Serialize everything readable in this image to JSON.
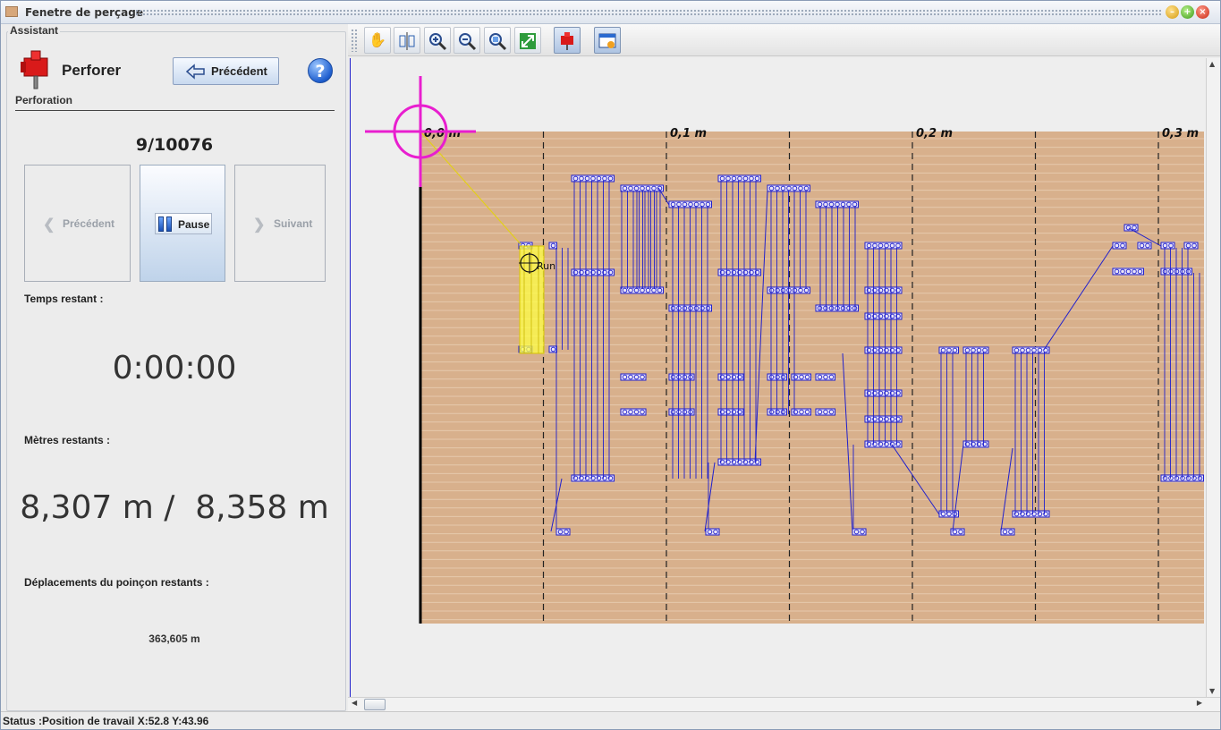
{
  "window": {
    "title": "Fenetre de perçage"
  },
  "assistant": {
    "group_title": "Assistant",
    "title": "Perforer",
    "subtitle": "Perforation",
    "prev_button": "Précédent",
    "help_icon": "help-icon",
    "counter": "9/10076",
    "controls": {
      "prev": "Précédent",
      "pause": "Pause",
      "next": "Suivant"
    },
    "time_label": "Temps restant :",
    "time_value": "0:00:00",
    "meters_label": "Mètres restants :",
    "meters_value": "8,307 m /  8,358 m",
    "moves_label": "Déplacements du poinçon restants :",
    "moves_value": "363,605 m"
  },
  "toolbar": {
    "tools": [
      "hand-pan-icon",
      "align-icon",
      "zoom-in-icon",
      "zoom-out-icon",
      "zoom-fit-icon",
      "fit-window-icon",
      "punch-icon",
      "settings-window-icon"
    ],
    "active_tool": "punch-icon"
  },
  "canvas": {
    "ruler_labels": [
      "0,0 m",
      "0,1 m",
      "0,2 m",
      "0,3 m"
    ],
    "cursor_label": "Run",
    "material_color": "#d8b08c",
    "path_color": "#2020cc",
    "marker_color": "#e81ecf",
    "highlight_color": "#ffff44"
  },
  "status": {
    "text": "Status :Position de travail X:52.8  Y:43.96"
  }
}
